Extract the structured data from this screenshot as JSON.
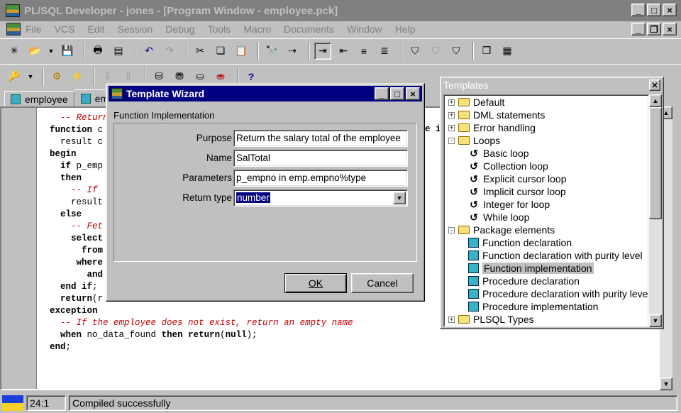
{
  "window": {
    "title": "PL/SQL Developer - jones - [Program Window - employee.pck]"
  },
  "menu": [
    "File",
    "VCS",
    "Edit",
    "Session",
    "Debug",
    "Tools",
    "Macro",
    "Documents",
    "Window",
    "Help"
  ],
  "tabs": [
    "employee",
    "em"
  ],
  "code_lines": [
    {
      "indent": "  ",
      "parts": [
        {
          "t": "-- Return",
          "c": "cm"
        }
      ]
    },
    {
      "indent": "",
      "parts": [
        {
          "t": "function",
          "c": "kw"
        },
        {
          "t": " c",
          "c": ""
        }
      ]
    },
    {
      "indent": "  ",
      "parts": [
        {
          "t": "result c",
          "c": ""
        }
      ]
    },
    {
      "indent": "",
      "parts": [
        {
          "t": "begin",
          "c": "kw"
        }
      ]
    },
    {
      "indent": "  ",
      "parts": [
        {
          "t": "if",
          "c": "kw"
        },
        {
          "t": " p_emp",
          "c": ""
        }
      ]
    },
    {
      "indent": "  ",
      "parts": [
        {
          "t": "then",
          "c": "kw"
        }
      ]
    },
    {
      "indent": "    ",
      "parts": [
        {
          "t": "-- If",
          "c": "cm"
        }
      ]
    },
    {
      "indent": "    ",
      "parts": [
        {
          "t": "result",
          "c": ""
        }
      ]
    },
    {
      "indent": "  ",
      "parts": [
        {
          "t": "else",
          "c": "kw"
        }
      ]
    },
    {
      "indent": "    ",
      "parts": [
        {
          "t": "-- Fet",
          "c": "cm"
        }
      ]
    },
    {
      "indent": "    ",
      "parts": [
        {
          "t": "select",
          "c": "kw"
        }
      ]
    },
    {
      "indent": "      ",
      "parts": [
        {
          "t": "from",
          "c": "kw"
        }
      ]
    },
    {
      "indent": "     ",
      "parts": [
        {
          "t": "where",
          "c": "kw"
        }
      ]
    },
    {
      "indent": "       ",
      "parts": [
        {
          "t": "and",
          "c": "kw"
        }
      ]
    },
    {
      "indent": "  ",
      "parts": [
        {
          "t": "end if",
          "c": "kw"
        },
        {
          "t": ";",
          "c": ""
        }
      ]
    },
    {
      "indent": "  ",
      "parts": [
        {
          "t": "return",
          "c": "kw"
        },
        {
          "t": "(r",
          "c": ""
        }
      ]
    },
    {
      "indent": "",
      "parts": [
        {
          "t": "exception",
          "c": "kw"
        }
      ]
    },
    {
      "indent": "  ",
      "parts": [
        {
          "t": "-- If the employee does not exist, return an empty name",
          "c": "cm"
        }
      ]
    },
    {
      "indent": "  ",
      "parts": [
        {
          "t": "when",
          "c": "kw"
        },
        {
          "t": " no_data_found ",
          "c": ""
        },
        {
          "t": "then",
          "c": "kw"
        },
        {
          "t": " ",
          "c": ""
        },
        {
          "t": "return",
          "c": "kw"
        },
        {
          "t": "(",
          "c": ""
        },
        {
          "t": "null",
          "c": "kw"
        },
        {
          "t": ");",
          "c": ""
        }
      ]
    },
    {
      "indent": "",
      "parts": [
        {
          "t": "end",
          "c": "kw"
        },
        {
          "t": ";",
          "c": ""
        }
      ]
    }
  ],
  "code_right_fragment": "e i",
  "templates": {
    "title": "Templates",
    "items": [
      {
        "label": "Default",
        "level": 0,
        "kind": "folder",
        "toggle": "+"
      },
      {
        "label": "DML statements",
        "level": 0,
        "kind": "folder",
        "toggle": "+"
      },
      {
        "label": "Error handling",
        "level": 0,
        "kind": "folder",
        "toggle": "+"
      },
      {
        "label": "Loops",
        "level": 0,
        "kind": "folder",
        "toggle": "-"
      },
      {
        "label": "Basic loop",
        "level": 1,
        "kind": "loop"
      },
      {
        "label": "Collection loop",
        "level": 1,
        "kind": "loop"
      },
      {
        "label": "Explicit cursor loop",
        "level": 1,
        "kind": "loop"
      },
      {
        "label": "Implicit cursor loop",
        "level": 1,
        "kind": "loop"
      },
      {
        "label": "Integer for loop",
        "level": 1,
        "kind": "loop"
      },
      {
        "label": "While loop",
        "level": 1,
        "kind": "loop"
      },
      {
        "label": "Package elements",
        "level": 0,
        "kind": "folder",
        "toggle": "-"
      },
      {
        "label": "Function declaration",
        "level": 1,
        "kind": "pkg"
      },
      {
        "label": "Function declaration with purity level",
        "level": 1,
        "kind": "pkg"
      },
      {
        "label": "Function implementation",
        "level": 1,
        "kind": "pkg",
        "selected": true
      },
      {
        "label": "Procedure declaration",
        "level": 1,
        "kind": "pkg"
      },
      {
        "label": "Procedure declaration with purity level",
        "level": 1,
        "kind": "pkg"
      },
      {
        "label": "Procedure implementation",
        "level": 1,
        "kind": "pkg"
      },
      {
        "label": "PLSQL Types",
        "level": 0,
        "kind": "folder",
        "toggle": "+"
      }
    ]
  },
  "wizard": {
    "title": "Template Wizard",
    "subtitle": "Function Implementation",
    "fields": [
      {
        "label": "Purpose",
        "value": "Return the salary total of the employee"
      },
      {
        "label": "Name",
        "value": "SalTotal"
      },
      {
        "label": "Parameters",
        "value": "p_empno in emp.empno%type"
      }
    ],
    "return_type": {
      "label": "Return type",
      "value": "number"
    },
    "ok_label": "OK",
    "cancel_label": "Cancel"
  },
  "status": {
    "position": "24:1",
    "message": "Compiled successfully"
  }
}
